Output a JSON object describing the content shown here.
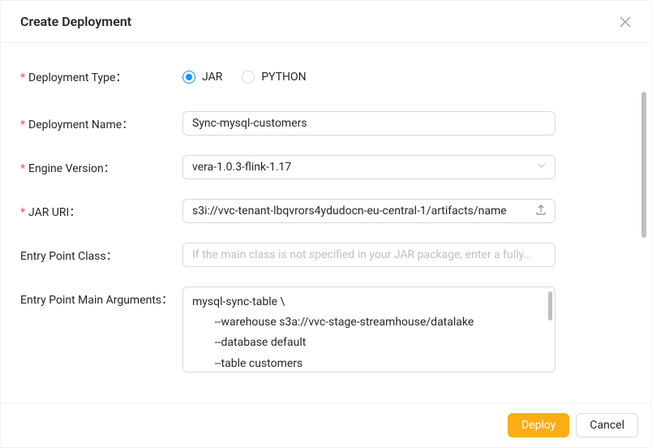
{
  "modal": {
    "title": "Create Deployment"
  },
  "form": {
    "deploymentTypeLabel": "Deployment Type：",
    "deploymentType": {
      "options": [
        {
          "label": "JAR",
          "checked": true
        },
        {
          "label": "PYTHON",
          "checked": false
        }
      ]
    },
    "deploymentNameLabel": "Deployment Name：",
    "deploymentName": "Sync-mysql-customers",
    "engineVersionLabel": "Engine Version：",
    "engineVersion": "vera-1.0.3-flink-1.17",
    "jarUriLabel": "JAR URI：",
    "jarUri": "s3i://vvc-tenant-lbqvrors4ydudocn-eu-central-1/artifacts/name",
    "entryPointClassLabel": "Entry Point Class：",
    "entryPointClassPlaceholder": "If the main class is not specified in your JAR package, enter a fully...",
    "entryPointArgsLabel": "Entry Point Main Arguments：",
    "entryPointArgs": "mysql-sync-table \\\n        --warehouse s3a://vvc-stage-streamhouse/datalake\n        --database default\n        --table customers\n        --primary-keys id"
  },
  "footer": {
    "deployLabel": "Deploy",
    "cancelLabel": "Cancel"
  }
}
